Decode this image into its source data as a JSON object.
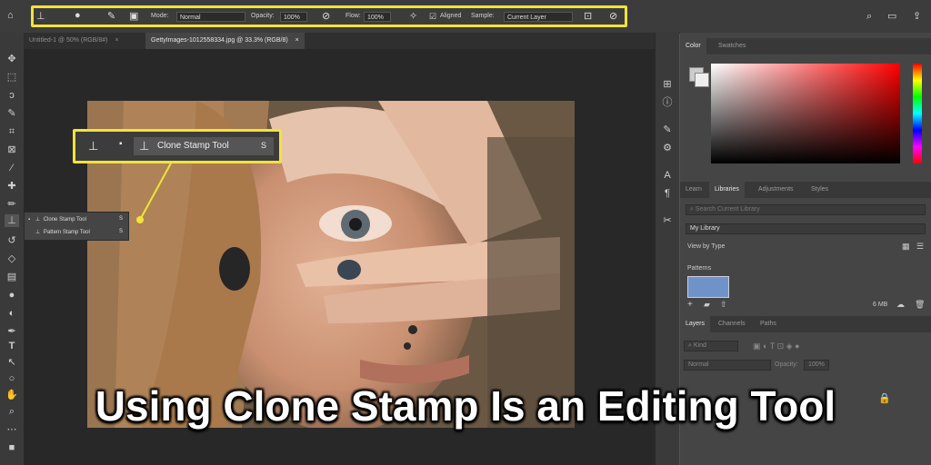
{
  "options_bar": {
    "mode_label": "Mode:",
    "mode_value": "Normal",
    "opacity_label": "Opacity:",
    "opacity_value": "100%",
    "flow_label": "Flow:",
    "flow_value": "100%",
    "aligned_label": "Aligned",
    "sample_label": "Sample:",
    "sample_value": "Current Layer"
  },
  "tabs": [
    {
      "label": "Untitled-1 @ 50% (RGB/8#)"
    },
    {
      "label": "GettyImages-1012558334.jpg @ 33.3% (RGB/8)"
    }
  ],
  "flyout": {
    "items": [
      {
        "label": "Clone Stamp Tool",
        "shortcut": "S"
      },
      {
        "label": "Pattern Stamp Tool",
        "shortcut": "S"
      }
    ]
  },
  "callout": {
    "label": "Clone Stamp Tool",
    "shortcut": "S"
  },
  "panels": {
    "color_tabs": [
      "Color",
      "Swatches"
    ],
    "library_tabs": [
      "Learn",
      "Libraries",
      "Adjustments",
      "Styles"
    ],
    "search_placeholder": "Search Current Library",
    "library_select": "My Library",
    "view_by": "View by Type",
    "patterns_label": "Patterns",
    "size": "6 MB",
    "layer_tabs": [
      "Layers",
      "Channels",
      "Paths"
    ],
    "kind_placeholder": "Kind",
    "blend_value": "Normal",
    "layer_opacity_label": "Opacity:",
    "layer_opacity_value": "100%"
  },
  "caption": "Using Clone Stamp Is an Editing Tool"
}
